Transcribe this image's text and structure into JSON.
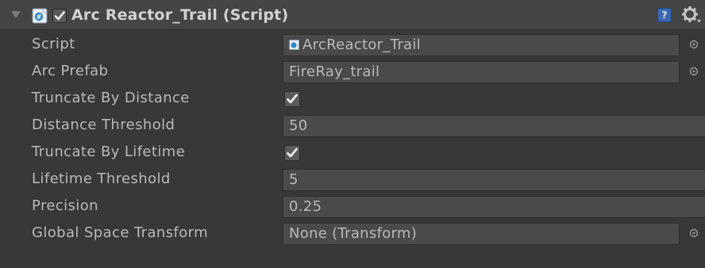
{
  "component": {
    "title": "Arc Reactor_Trail (Script)",
    "enabled": true,
    "help_label": "?"
  },
  "fields": [
    {
      "label": "Script",
      "type": "object",
      "value": "ArcReactor_Trail",
      "icon": "script-icon",
      "picker": true
    },
    {
      "label": "Arc Prefab",
      "type": "object",
      "value": "FireRay_trail",
      "picker": true
    },
    {
      "label": "Truncate By Distance",
      "type": "checkbox",
      "checked": true
    },
    {
      "label": "Distance Threshold",
      "type": "number",
      "value": "50"
    },
    {
      "label": "Truncate By Lifetime",
      "type": "checkbox",
      "checked": true
    },
    {
      "label": "Lifetime Threshold",
      "type": "number",
      "value": "5"
    },
    {
      "label": "Precision",
      "type": "number",
      "value": "0.25"
    },
    {
      "label": "Global Space Transform",
      "type": "object",
      "value": "None (Transform)",
      "picker": true
    }
  ],
  "colors": {
    "background": "#383838",
    "header": "#454545",
    "field_bg": "#4a4a4a",
    "text": "#b9b9b9",
    "help_blue": "#3d66b0"
  }
}
